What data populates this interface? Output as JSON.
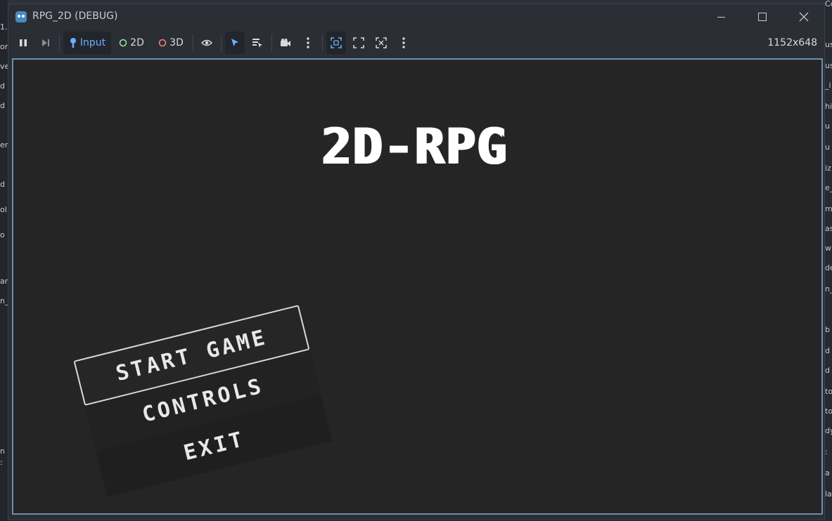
{
  "window": {
    "title": "RPG_2D (DEBUG)",
    "controls": {
      "minimize": "minimize",
      "maximize": "maximize",
      "close": "close"
    }
  },
  "toolbar": {
    "input_label": "Input",
    "mode_2d_label": "2D",
    "mode_3d_label": "3D",
    "resolution": "1152x648"
  },
  "game": {
    "title": "2D-RPG",
    "menu": [
      {
        "label": "START GAME"
      },
      {
        "label": "CONTROLS"
      },
      {
        "label": "EXIT"
      }
    ]
  },
  "background": {
    "left_snippets": [
      "1.",
      "or",
      "ve",
      "d",
      "d",
      "er",
      "d",
      "ol",
      "o",
      "ar",
      "n_",
      "n",
      ":"
    ],
    "right_snippets": [
      "Contro",
      "us",
      "us",
      "_i",
      "hi",
      "u",
      "u",
      "iz",
      "e_",
      "m",
      "as",
      "w",
      "de",
      "n_",
      "b",
      "d",
      "d",
      "to",
      "to",
      "dy",
      ":",
      "a",
      "la"
    ]
  },
  "colors": {
    "accent": "#478cbf",
    "input_active": "#6ab0ff",
    "mode_2d": "#8eef97",
    "mode_3d": "#fc7f7f",
    "viewport_border": "#6a8fb0"
  }
}
